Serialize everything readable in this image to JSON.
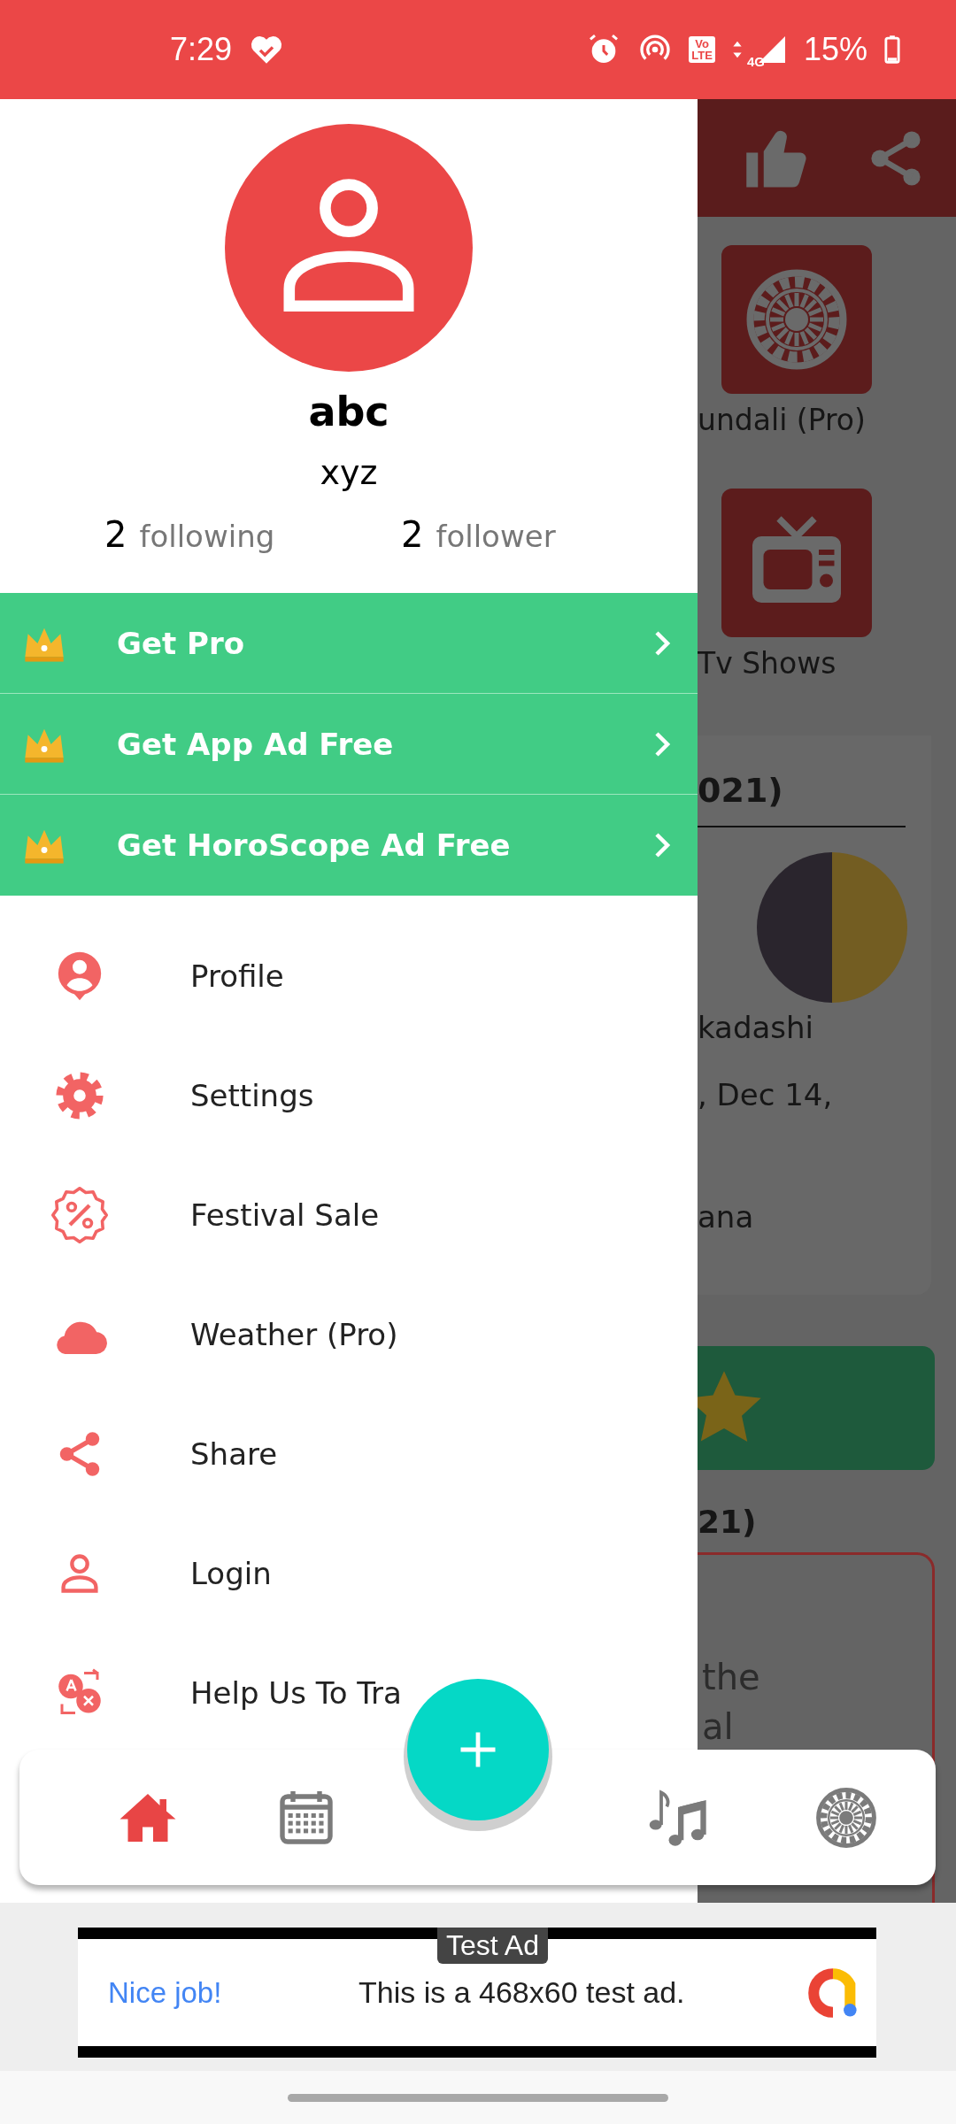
{
  "status_bar": {
    "time": "7:29",
    "volte": [
      "Vo",
      "LTE"
    ],
    "network": "4G",
    "battery": "15%"
  },
  "drawer": {
    "profile": {
      "name": "abc",
      "handle": "xyz",
      "following_count": "2",
      "following_label": "following",
      "follower_count": "2",
      "follower_label": "follower"
    },
    "promos": [
      {
        "label": "Get Pro"
      },
      {
        "label": "Get App Ad Free"
      },
      {
        "label": "Get HoroScope Ad Free"
      }
    ],
    "menu": [
      {
        "kind": "profile",
        "label": "Profile"
      },
      {
        "kind": "settings",
        "label": "Settings"
      },
      {
        "kind": "sale",
        "label": "Festival Sale"
      },
      {
        "kind": "weather",
        "label": "Weather (Pro)"
      },
      {
        "kind": "share",
        "label": "Share"
      },
      {
        "kind": "login",
        "label": "Login"
      },
      {
        "kind": "translate",
        "label": "Help Us To Tra"
      }
    ]
  },
  "background": {
    "tiles": [
      {
        "kind": "wheel",
        "label": "undali (Pro)"
      },
      {
        "kind": "tv",
        "label": "Tv Shows"
      }
    ],
    "card_title": "021)",
    "card_lines": [
      "kadashi",
      ", Dec 14,",
      "ana"
    ],
    "section_title": "21)",
    "box_lines": [
      "the",
      "al"
    ]
  },
  "bottom_nav": {
    "items": [
      {
        "kind": "home",
        "selected": true
      },
      {
        "kind": "calendar",
        "selected": false
      },
      {
        "kind": "music",
        "selected": false
      },
      {
        "kind": "wheel",
        "selected": false
      }
    ]
  },
  "ad": {
    "badge": "Test Ad",
    "headline": "Nice job!",
    "text": "This is a 468x60 test ad."
  }
}
